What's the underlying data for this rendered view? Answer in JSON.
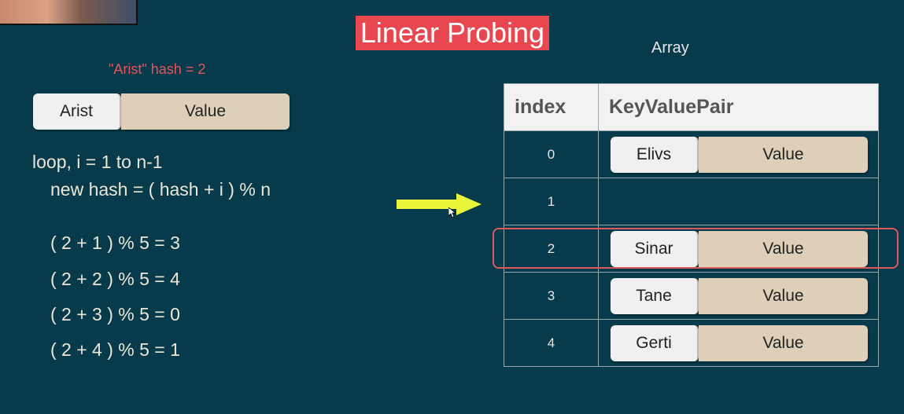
{
  "title": "Linear Probing",
  "array_label": "Array",
  "hash_note": "\"Arist\" hash = 2",
  "new_pair": {
    "key": "Arist",
    "value": "Value"
  },
  "code": {
    "loop": "loop, i = 1 to n-1",
    "new_hash": "new hash = ( hash + i ) % n",
    "steps": [
      "( 2 + 1 ) % 5 = 3",
      "( 2 + 2 ) % 5 = 4",
      "( 2 + 3 ) % 5 = 0",
      "( 2 + 4 ) % 5 = 1"
    ]
  },
  "table": {
    "headers": [
      "index",
      "KeyValuePair"
    ],
    "rows": [
      {
        "index": "0",
        "key": "Elivs",
        "value": "Value"
      },
      {
        "index": "1",
        "key": "",
        "value": ""
      },
      {
        "index": "2",
        "key": "Sinar",
        "value": "Value"
      },
      {
        "index": "3",
        "key": "Tane",
        "value": "Value"
      },
      {
        "index": "4",
        "key": "Gerti",
        "value": "Value"
      }
    ]
  },
  "highlighted_row": 2,
  "colors": {
    "background": "#073b4c",
    "title_bg": "#e8474f",
    "arrow": "#e8f53a",
    "key_bg": "#f0f0f0",
    "value_bg": "#ded0b8",
    "highlight": "#d9595f"
  }
}
